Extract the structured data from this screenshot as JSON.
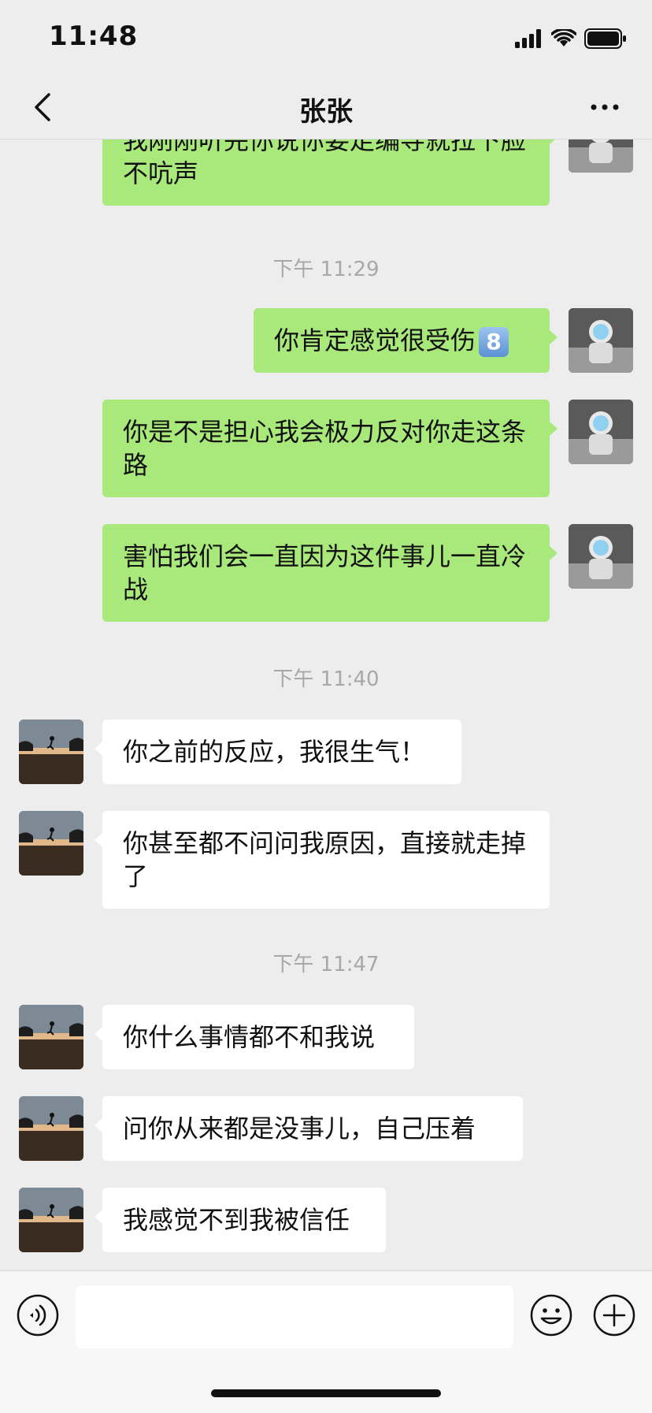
{
  "status_bar": {
    "time": "11:48"
  },
  "header": {
    "title": "张张"
  },
  "messages": [
    {
      "type": "out",
      "text": "我刚刚听完你说你要走编导就拉下脸不吭声"
    },
    {
      "type": "time",
      "text": "下午 11:29"
    },
    {
      "type": "out",
      "text": "你肯定感觉很受伤",
      "emoji": "8"
    },
    {
      "type": "out",
      "text": "你是不是担心我会极力反对你走这条路"
    },
    {
      "type": "out",
      "text": "害怕我们会一直因为这件事儿一直冷战"
    },
    {
      "type": "time",
      "text": "下午 11:40"
    },
    {
      "type": "in",
      "text": "你之前的反应，我很生气！"
    },
    {
      "type": "in",
      "text": "你甚至都不问问我原因，直接就走掉了"
    },
    {
      "type": "time",
      "text": "下午 11:47"
    },
    {
      "type": "in",
      "text": "你什么事情都不和我说"
    },
    {
      "type": "in",
      "text": "问你从来都是没事儿，自己压着"
    },
    {
      "type": "in",
      "text": "我感觉不到我被信任"
    }
  ],
  "input_bar": {
    "value": "",
    "voice_icon": "voice-icon",
    "emoji_icon": "emoji-icon",
    "plus_icon": "plus-icon"
  },
  "colors": {
    "outgoing_bubble": "#a9e87a",
    "incoming_bubble": "#ffffff",
    "background": "#ededed"
  }
}
